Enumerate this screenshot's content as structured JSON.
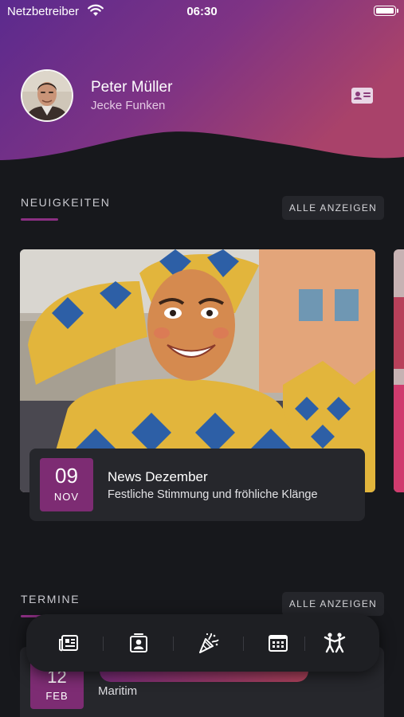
{
  "status_bar": {
    "carrier": "Netzbetreiber",
    "time": "06:30",
    "icons": [
      "wifi-icon",
      "battery-icon"
    ]
  },
  "profile": {
    "name": "Peter Müller",
    "club": "Jecke Funken",
    "avatar_icon": "avatar",
    "card_icon": "id-card-icon"
  },
  "news": {
    "title": "NEUIGKEITEN",
    "show_all_label": "ALLE ANZEIGEN",
    "items": [
      {
        "day": "09",
        "month": "NOV",
        "title": "News Dezember",
        "teaser": "Festliche Stimmung und fröhliche Klänge"
      }
    ]
  },
  "events": {
    "title": "TERMINE",
    "show_all_label": "ALLE ANZEIGEN",
    "items": [
      {
        "day": "12",
        "month": "FEB",
        "place": "Maritim"
      }
    ]
  },
  "tabbar": {
    "tabs": [
      {
        "icon": "newspaper-icon"
      },
      {
        "icon": "contact-icon"
      },
      {
        "icon": "party-popper-icon"
      },
      {
        "icon": "calendar-icon"
      },
      {
        "icon": "dancing-people-icon"
      }
    ]
  },
  "colors": {
    "accent": "#7d2c73",
    "background": "#17181c",
    "card": "#26272c",
    "header_gradient_start": "#5b2a8e",
    "header_gradient_end": "#a23f69"
  }
}
